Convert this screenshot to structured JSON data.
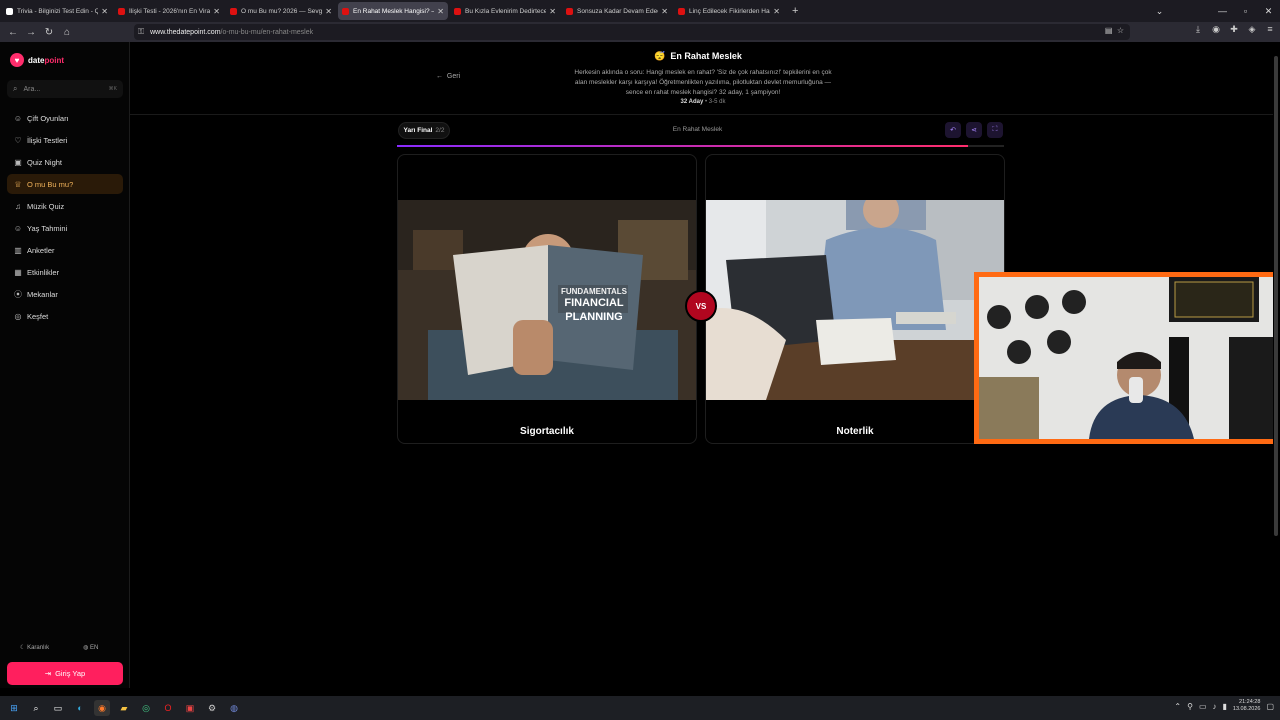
{
  "browser": {
    "tabs": [
      {
        "title": "Trivia - Bilginizi Test Edin - Quiz",
        "active": false
      },
      {
        "title": "İlişki Testi - 2026'nın En Viral Te",
        "active": false
      },
      {
        "title": "O mu Bu mu? 2026 — Sevgilin",
        "active": false
      },
      {
        "title": "En Rahat Meslek Hangisi? — Si",
        "active": true
      },
      {
        "title": "Bu Kızla Evlenirim Dedirtecek Ö",
        "active": false
      },
      {
        "title": "Sonsuza Kadar Devam Edecek İ",
        "active": false
      },
      {
        "title": "Linç Edilecek Fikirlerden Hangi",
        "active": false
      }
    ],
    "url_domain": "www.thedatepoint.com",
    "url_path": "/o-mu-bu-mu/en-rahat-meslek"
  },
  "sidebar": {
    "logo_part1": "date",
    "logo_part2": "point",
    "search_placeholder": "Ara...",
    "search_shortcut": "⌘K",
    "items": [
      {
        "label": "Çift Oyunları",
        "icon": "☺",
        "active": false
      },
      {
        "label": "İlişki Testleri",
        "icon": "♡",
        "active": false
      },
      {
        "label": "Quiz Night",
        "icon": "▣",
        "active": false
      },
      {
        "label": "O mu Bu mu?",
        "icon": "♕",
        "active": true
      },
      {
        "label": "Müzik Quiz",
        "icon": "♫",
        "active": false
      },
      {
        "label": "Yaş Tahmini",
        "icon": "☺",
        "active": false
      },
      {
        "label": "Anketler",
        "icon": "▥",
        "active": false
      },
      {
        "label": "Etkinlikler",
        "icon": "▦",
        "active": false
      },
      {
        "label": "Mekanlar",
        "icon": "⦿",
        "active": false
      },
      {
        "label": "Keşfet",
        "icon": "◎",
        "active": false
      }
    ],
    "theme_label": "Karanlık",
    "lang_label": "EN",
    "login_label": "Giriş Yap"
  },
  "page": {
    "back_label": "Geri",
    "emoji": "😴",
    "title": "En Rahat Meslek",
    "description": "Herkesin aklında o soru: Hangi meslek en rahat? 'Siz de çok rahatsınız!' tepkilerini en çok alan meslekler karşı karşıya! Öğretmenlikten yazılıma, pilotluktan devlet memurluğuna — sence en rahat meslek hangisi? 32 aday, 1 şampiyon!",
    "candidates": "32 Aday",
    "duration": "3-5 dk",
    "round_label": "Yarı Final",
    "round_progress": "2/2",
    "center_title": "En Rahat Meslek",
    "progress": 0.94,
    "vs_label": "VS",
    "left_option": "Sigortacılık",
    "right_option": "Noterlik"
  },
  "taskbar": {
    "time": "21:24:28",
    "date": "13.08.2026"
  },
  "colors": {
    "accent": "#ff1f5e",
    "active_menu": "#f0b25a",
    "vs": "#b1061f",
    "webcam_border": "#ff6a13"
  }
}
